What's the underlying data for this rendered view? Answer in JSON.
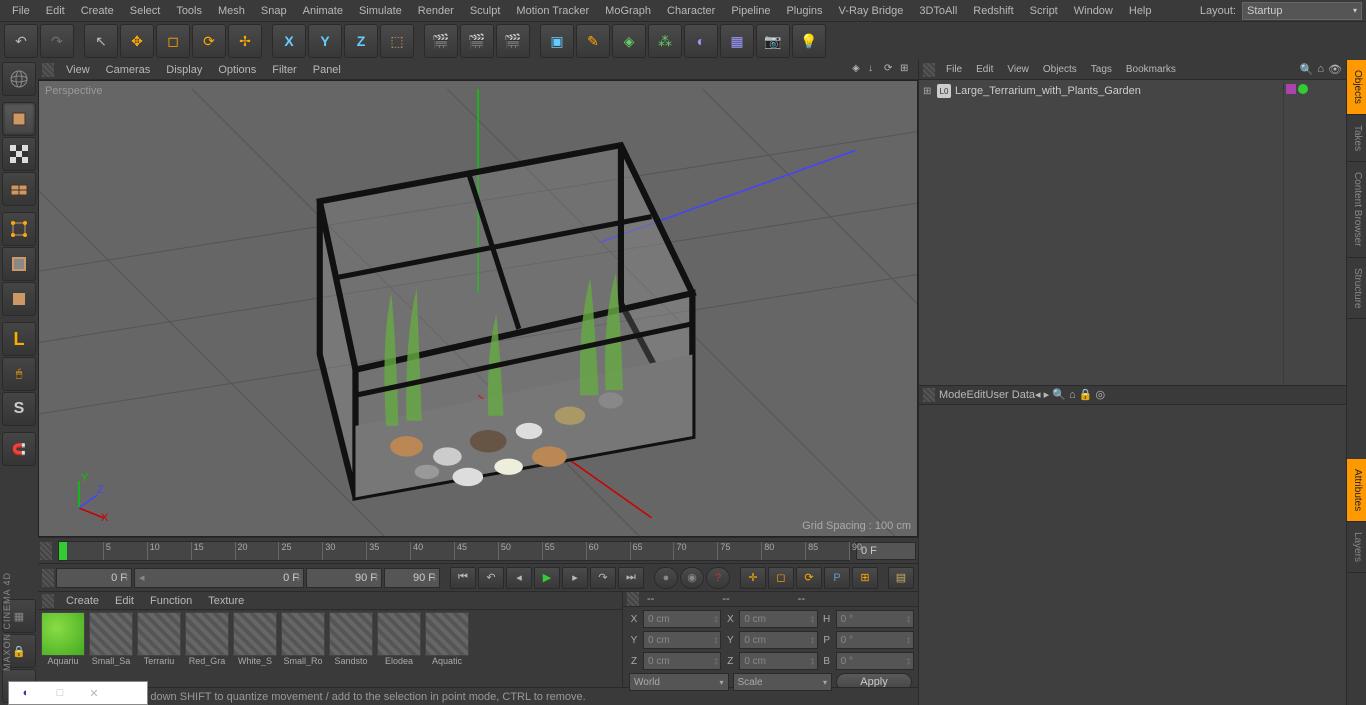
{
  "menubar": [
    "File",
    "Edit",
    "Create",
    "Select",
    "Tools",
    "Mesh",
    "Snap",
    "Animate",
    "Simulate",
    "Render",
    "Sculpt",
    "Motion Tracker",
    "MoGraph",
    "Character",
    "Pipeline",
    "Plugins",
    "V-Ray Bridge",
    "3DToAll",
    "Redshift",
    "Script",
    "Window",
    "Help"
  ],
  "layout": {
    "label": "Layout:",
    "value": "Startup"
  },
  "viewport_menu": [
    "View",
    "Cameras",
    "Display",
    "Options",
    "Filter",
    "Panel"
  ],
  "viewport": {
    "label": "Perspective",
    "grid": "Grid Spacing : 100 cm"
  },
  "timeline": {
    "ticks": [
      "0",
      "5",
      "10",
      "15",
      "20",
      "25",
      "30",
      "35",
      "40",
      "45",
      "50",
      "55",
      "60",
      "65",
      "70",
      "75",
      "80",
      "85",
      "90"
    ],
    "end": "0 F"
  },
  "playback": {
    "f1": "0 F",
    "f2": "0 F",
    "f3": "90 F",
    "f4": "90 F"
  },
  "materials_menu": [
    "Create",
    "Edit",
    "Function",
    "Texture"
  ],
  "materials": [
    {
      "name": "Aquariu",
      "green": true
    },
    {
      "name": "Small_Sa"
    },
    {
      "name": "Terrariu"
    },
    {
      "name": "Red_Gra"
    },
    {
      "name": "White_S"
    },
    {
      "name": "Small_Ro"
    },
    {
      "name": "Sandsto"
    },
    {
      "name": "Elodea"
    },
    {
      "name": "Aquatic"
    }
  ],
  "coords": {
    "header": [
      "--",
      "--",
      "--"
    ],
    "rows": [
      {
        "a": "X",
        "av": "0 cm",
        "b": "X",
        "bv": "0 cm",
        "c": "H",
        "cv": "0 °"
      },
      {
        "a": "Y",
        "av": "0 cm",
        "b": "Y",
        "bv": "0 cm",
        "c": "P",
        "cv": "0 °"
      },
      {
        "a": "Z",
        "av": "0 cm",
        "b": "Z",
        "bv": "0 cm",
        "c": "B",
        "cv": "0 °"
      }
    ],
    "drop1": "World",
    "drop2": "Scale",
    "apply": "Apply"
  },
  "objects_menu": [
    "File",
    "Edit",
    "View",
    "Objects",
    "Tags",
    "Bookmarks"
  ],
  "object": {
    "name": "Large_Terrarium_with_Plants_Garden"
  },
  "attr_menu": [
    "Mode",
    "Edit",
    "User Data"
  ],
  "right_tabs": [
    "Objects",
    "Takes",
    "Content Browser",
    "Structure",
    "Attributes",
    "Layers"
  ],
  "status": "move elements. Hold down SHIFT to quantize movement / add to the selection in point mode, CTRL to remove.",
  "brand": "MAXON CINEMA 4D"
}
